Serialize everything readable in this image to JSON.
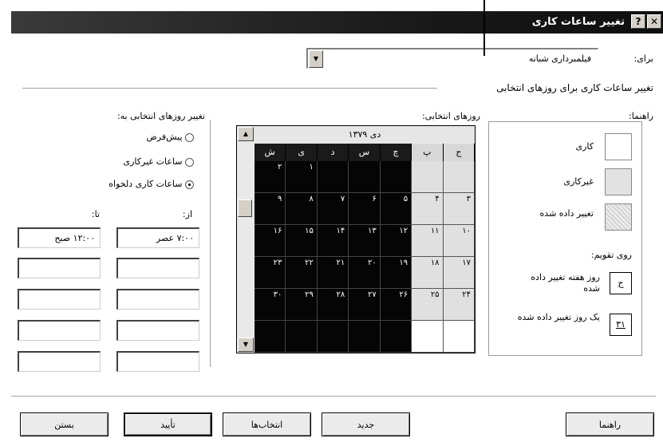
{
  "window": {
    "title": "تغییر ساعات کاری",
    "help_glyph": "?",
    "close_glyph": "✕"
  },
  "for_field": {
    "label": "برای:",
    "value": "فیلمبرداری شبانه"
  },
  "section_title": "تغییر ساعات کاری برای روزهای انتخابی",
  "legend": {
    "title": "راهنما:",
    "items": [
      "کاری",
      "غیرکاری",
      "تغییر داده شده"
    ],
    "on_calendar_title": "روی تقویم:",
    "edited_day_label": "روز هفته تغییر داده شده",
    "edited_day_sample": "ج",
    "single_day_label": "یک روز تغییر داده شده",
    "single_day_sample": "۳۱"
  },
  "calendar": {
    "label": "روزهای انتخابی:",
    "month": "دی ۱۳۷۹",
    "weekday_headers": [
      "ج",
      "پ",
      "چ",
      "س",
      "د",
      "ی",
      "ش"
    ],
    "rows": [
      [
        "",
        "",
        "",
        "",
        "",
        "۱",
        "۲"
      ],
      [
        "۳",
        "۴",
        "۵",
        "۶",
        "۷",
        "۸",
        "۹"
      ],
      [
        "۱۰",
        "۱۱",
        "۱۲",
        "۱۳",
        "۱۴",
        "۱۵",
        "۱۶"
      ],
      [
        "۱۷",
        "۱۸",
        "۱۹",
        "۲۰",
        "۲۱",
        "۲۲",
        "۲۳"
      ],
      [
        "۲۴",
        "۲۵",
        "۲۶",
        "۲۷",
        "۲۸",
        "۲۹",
        "۳۰"
      ],
      [
        "",
        "",
        "",
        "",
        "",
        "",
        ""
      ]
    ]
  },
  "change_to": {
    "title": "تغییر روزهای انتخابی به:",
    "options": [
      "پیش‌فرض",
      "ساعات غیرکاری",
      "ساعات کاری دلخواه"
    ],
    "selected_index": 2,
    "from_label": "از:",
    "to_label": "تا:",
    "times": [
      {
        "from": "۷:۰۰ عصر",
        "to": "۱۲:۰۰ صبح"
      },
      {
        "from": "",
        "to": ""
      },
      {
        "from": "",
        "to": ""
      },
      {
        "from": "",
        "to": ""
      },
      {
        "from": "",
        "to": ""
      }
    ]
  },
  "buttons": {
    "help": "راهنما",
    "new": "جدید",
    "options": "انتخاب‌ها",
    "ok": "تأیید",
    "cancel": "بستن"
  }
}
